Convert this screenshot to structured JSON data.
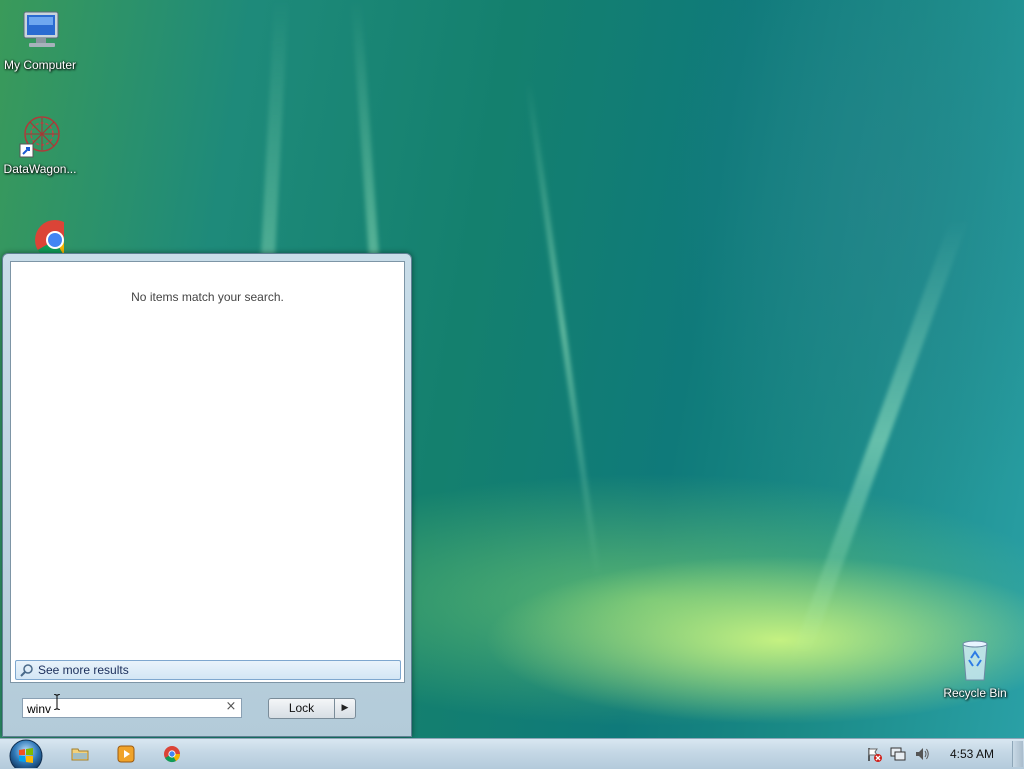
{
  "desktop": {
    "icons": [
      {
        "label": "My Computer",
        "icon": "computer-icon"
      },
      {
        "label": "DataWagon...",
        "icon": "datawagon-icon"
      },
      {
        "label": "",
        "icon": "chrome-icon"
      },
      {
        "label": "Recycle Bin",
        "icon": "recycle-bin-icon"
      }
    ]
  },
  "start_menu": {
    "no_results_text": "No items match your search.",
    "see_more_label": "See more results",
    "search": {
      "value": "winv",
      "clear_icon": "clear-icon"
    },
    "power_button_label": "Lock",
    "power_arrow_icon": "arrow-right-icon"
  },
  "taskbar": {
    "start_icon": "windows-orb-icon",
    "pinned": [
      {
        "name": "explorer",
        "icon": "folder-icon"
      },
      {
        "name": "media-player",
        "icon": "media-player-icon"
      },
      {
        "name": "chrome",
        "icon": "chrome-icon"
      }
    ],
    "tray": {
      "icons": [
        "action-center-flag-icon",
        "network-icon",
        "volume-icon"
      ],
      "clock": "4:53 AM"
    }
  },
  "colors": {
    "taskbar_top": "#d9e7f1",
    "menu_bg": "#c9dde9",
    "link_blue": "#1a2d5a"
  }
}
